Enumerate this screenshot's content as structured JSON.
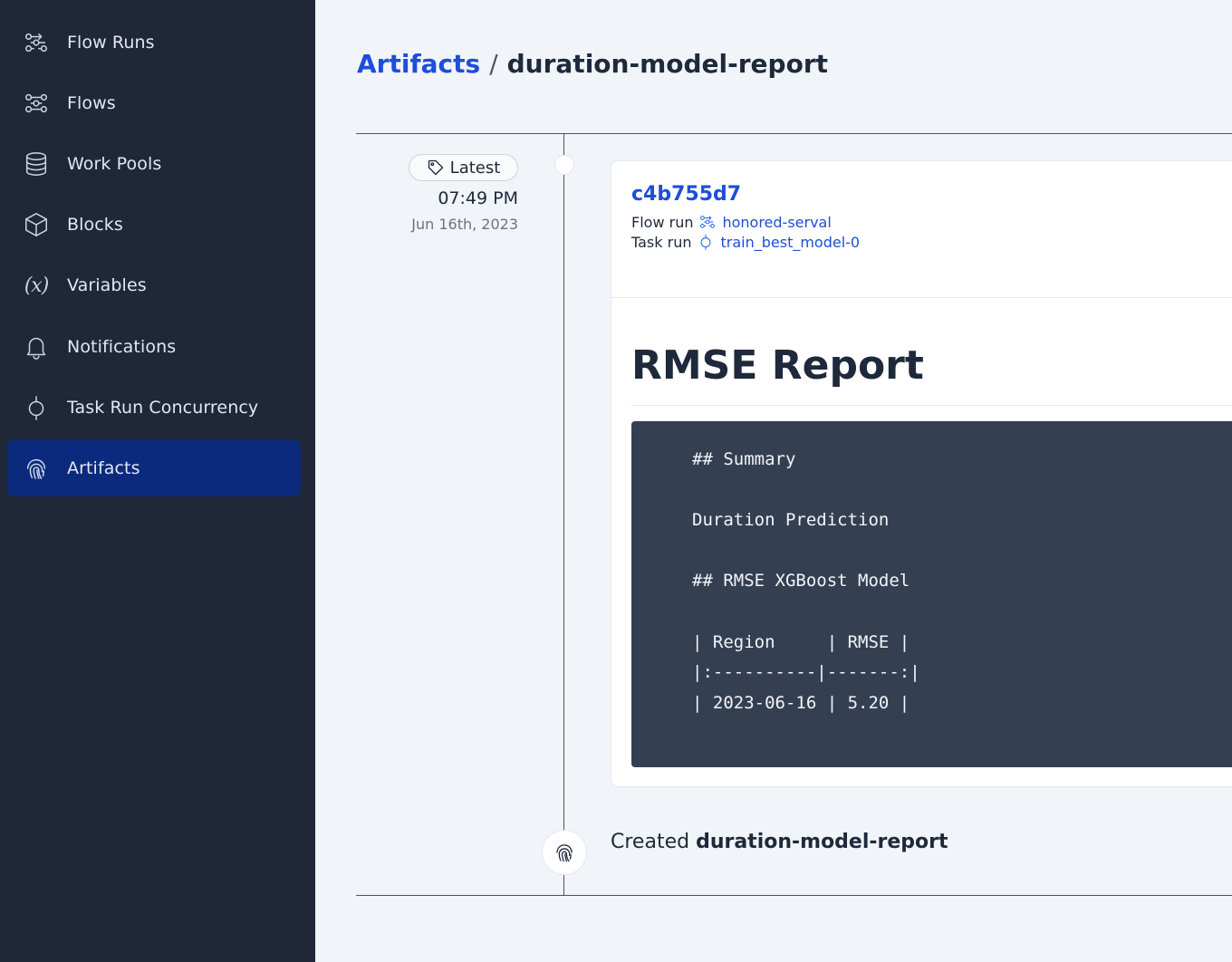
{
  "sidebar": {
    "items": [
      {
        "label": "Flow Runs",
        "icon": "flow-runs-icon",
        "active": false
      },
      {
        "label": "Flows",
        "icon": "flows-icon",
        "active": false
      },
      {
        "label": "Work Pools",
        "icon": "database-icon",
        "active": false
      },
      {
        "label": "Blocks",
        "icon": "cube-icon",
        "active": false
      },
      {
        "label": "Variables",
        "icon": "variable-icon",
        "icon_text": "(x)",
        "active": false
      },
      {
        "label": "Notifications",
        "icon": "bell-icon",
        "active": false
      },
      {
        "label": "Task Run Concurrency",
        "icon": "task-run-icon",
        "active": false
      },
      {
        "label": "Artifacts",
        "icon": "fingerprint-icon",
        "active": true
      }
    ]
  },
  "header": {
    "breadcrumb_parent": "Artifacts",
    "breadcrumb_separator": "/",
    "breadcrumb_current": "duration-model-report"
  },
  "timeline": {
    "tag_label": "Latest",
    "time": "07:49 PM",
    "date": "Jun 16th, 2023"
  },
  "card": {
    "id": "c4b755d7",
    "flow_run_label": "Flow run",
    "flow_run_value": "honored-serval",
    "task_run_label": "Task run",
    "task_run_value": "train_best_model-0",
    "report_title": "RMSE Report",
    "code_lines": [
      "## Summary",
      "",
      "Duration Prediction",
      "",
      "## RMSE XGBoost Model",
      "",
      "| Region     | RMSE |",
      "|:----------|-------:|",
      "| 2023-06-16 | 5.20 |"
    ]
  },
  "event": {
    "prefix": "Created",
    "name": "duration-model-report"
  },
  "colors": {
    "sidebar_bg": "#1f2739",
    "active_item": "#0b2a7e",
    "link": "#1d4ed8",
    "code_bg": "#353f52",
    "page_bg": "#f1f4f8"
  }
}
